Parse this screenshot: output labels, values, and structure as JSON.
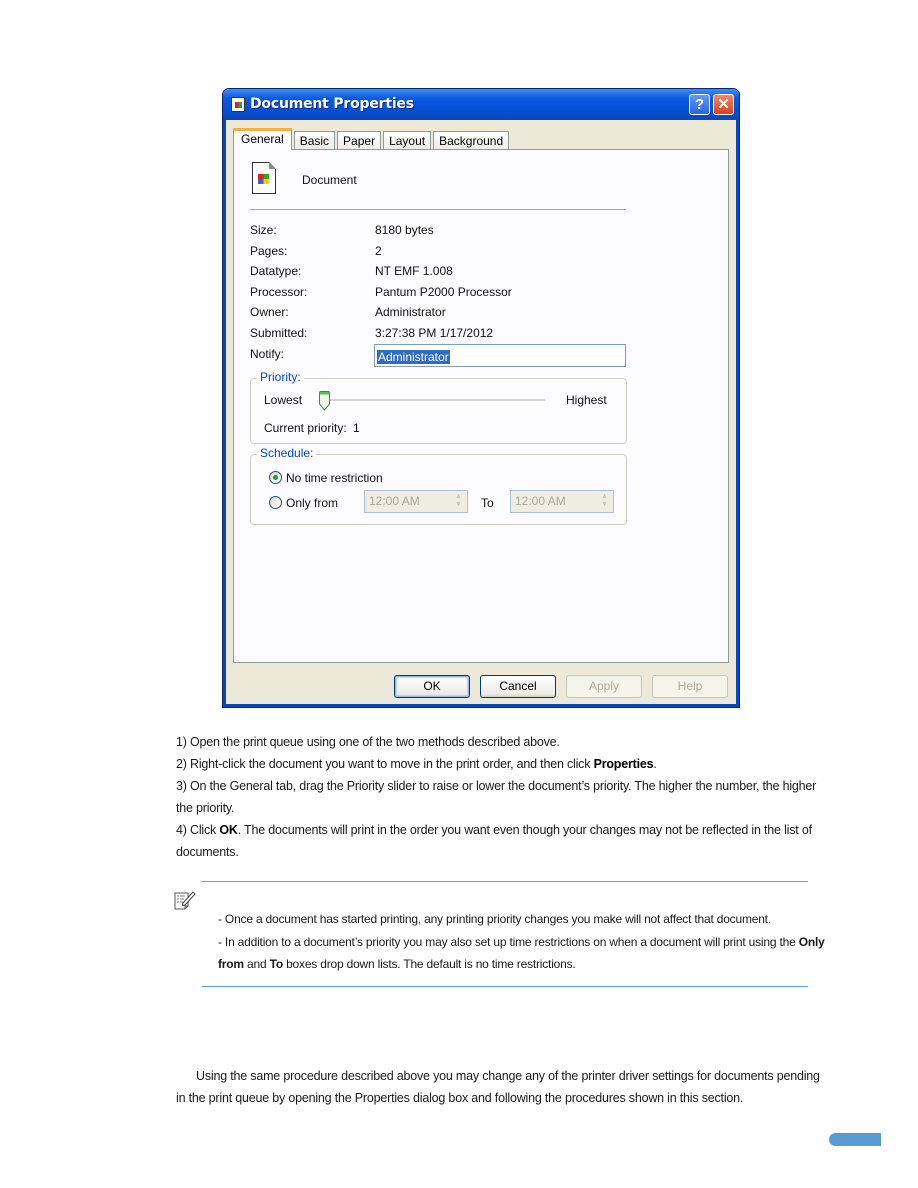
{
  "dialog": {
    "title": "Document Properties",
    "help_button": "?",
    "close_button": "✕",
    "tabs": [
      {
        "label": "General",
        "active": true
      },
      {
        "label": "Basic",
        "active": false
      },
      {
        "label": "Paper",
        "active": false
      },
      {
        "label": "Layout",
        "active": false
      },
      {
        "label": "Background",
        "active": false
      }
    ],
    "document_name": "Document",
    "properties": [
      {
        "label": "Size:",
        "value": "8180 bytes"
      },
      {
        "label": "Pages:",
        "value": "2"
      },
      {
        "label": "Datatype:",
        "value": "NT EMF 1.008"
      },
      {
        "label": "Processor:",
        "value": "Pantum P2000 Processor"
      },
      {
        "label": "Owner:",
        "value": "Administrator"
      },
      {
        "label": "Submitted:",
        "value": "3:27:38 PM  1/17/2012"
      }
    ],
    "notify": {
      "label": "Notify:",
      "value": "Administrator"
    },
    "priority": {
      "title": "Priority:",
      "lowest_label": "Lowest",
      "highest_label": "Highest",
      "current_label": "Current priority:",
      "current_value": "1",
      "slider_fraction": 0.0
    },
    "schedule": {
      "title": "Schedule:",
      "option_no_restriction": "No time restriction",
      "option_only_from": "Only from",
      "selected": "No time restriction",
      "from_time": "12:00 AM",
      "to_label": "To",
      "to_time": "12:00 AM"
    },
    "buttons": {
      "ok": "OK",
      "cancel": "Cancel",
      "apply": "Apply",
      "help": "Help"
    }
  },
  "steps": {
    "s1": "1) Open the print queue using one of the two methods described above.",
    "s2_pre": "2) Right-click the document you want to move in the print order, and then click ",
    "s2_bold": "Properties",
    "s2_post": ".",
    "s3_line1": "3) On the General tab, drag the Priority slider to raise or lower the document’s priority. The higher the number, the higher",
    "s3_line2": "the priority.",
    "s4_pre": "4) Click ",
    "s4_bold": "OK",
    "s4_post": ". The documents will print in the order you want even though your changes may not be reflected in the list of",
    "s4_line2": "documents."
  },
  "note": {
    "icon": "note-pencil-icon",
    "line1": "- Once a document has started printing, any printing priority changes you make will not affect that document.",
    "line2_pre": "- In addition to a document’s priority you may also set up time restrictions on when a document will print using the ",
    "line2_bold": "Only",
    "line3_bold1": "from",
    "line3_mid": " and ",
    "line3_bold2": "To",
    "line3_post": " boxes drop down lists. The default is no time restrictions."
  },
  "closing": {
    "line1": "Using the same procedure described above you may change any of the printer driver settings for documents pending",
    "line2": "in the print queue by opening the Properties dialog box and following the procedures shown in this section."
  }
}
